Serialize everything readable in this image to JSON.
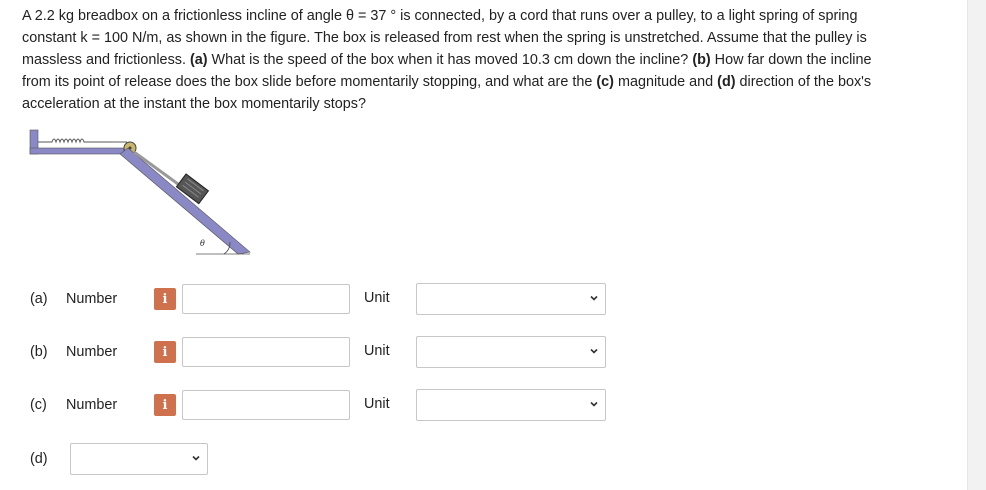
{
  "problem": {
    "line1": "A 2.2 kg breadbox on a frictionless incline of angle θ = 37 ° is connected, by a cord that runs over a pulley, to a light spring of spring",
    "line2": "constant k = 100 N/m, as shown in the figure. The box is released from rest when the spring is unstretched. Assume that the pulley is",
    "line3_a": "massless and frictionless. ",
    "line3_b": "(a)",
    "line3_c": " What is the speed of the box when it has moved 10.3 cm down the incline? ",
    "line3_d": "(b)",
    "line3_e": " How far down the incline",
    "line4_a": "from its point of release does the box slide before momentarily stopping, and what are the ",
    "line4_b": "(c)",
    "line4_c": " magnitude and ",
    "line4_d": "(d)",
    "line4_e": " direction of the box's",
    "line5": "acceleration at the instant the box momentarily stops?"
  },
  "figure": {
    "angle_label": "θ"
  },
  "answers": [
    {
      "part": "(a)",
      "number_label": "Number",
      "info": "i",
      "unit_label": "Unit"
    },
    {
      "part": "(b)",
      "number_label": "Number",
      "info": "i",
      "unit_label": "Unit"
    },
    {
      "part": "(c)",
      "number_label": "Number",
      "info": "i",
      "unit_label": "Unit"
    }
  ],
  "part_d": {
    "part": "(d)"
  },
  "colors": {
    "info_button": "#d0714e",
    "figure_purple": "#8b88c6"
  }
}
